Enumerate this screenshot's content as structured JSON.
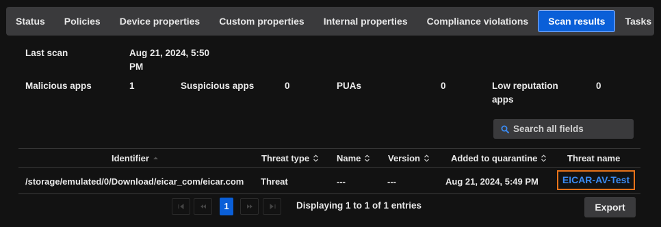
{
  "tabs": [
    "Status",
    "Policies",
    "Device properties",
    "Custom properties",
    "Internal properties",
    "Compliance violations",
    "Scan results",
    "Tasks"
  ],
  "active_tab": "Scan results",
  "summary": {
    "last_scan_label": "Last scan",
    "last_scan_value_line1": "Aug 21, 2024, 5:50",
    "last_scan_value_line2": "PM",
    "malicious_label": "Malicious apps",
    "malicious_value": "1",
    "suspicious_label": "Suspicious apps",
    "suspicious_value": "0",
    "puas_label": "PUAs",
    "puas_value": "0",
    "lowrep_label_line1": "Low reputation",
    "lowrep_label_line2": "apps",
    "lowrep_value": "0"
  },
  "search": {
    "placeholder": "Search all fields",
    "icon": "search-icon"
  },
  "table": {
    "columns": [
      "Identifier",
      "Threat type",
      "Name",
      "Version",
      "Added to quarantine",
      "Threat name"
    ],
    "rows": [
      {
        "identifier": "/storage/emulated/0/Download/eicar_com/eicar.com",
        "threat_type": "Threat",
        "name": "---",
        "version": "---",
        "added": "Aug 21, 2024, 5:49 PM",
        "threat_name": "EICAR-AV-Test"
      }
    ]
  },
  "pager": {
    "current_page": "1",
    "entries_text": "Displaying 1 to 1 of 1 entries"
  },
  "export_label": "Export",
  "colors": {
    "accent": "#0a5fd8",
    "highlight": "#e8731a",
    "link": "#3b8cf5"
  }
}
